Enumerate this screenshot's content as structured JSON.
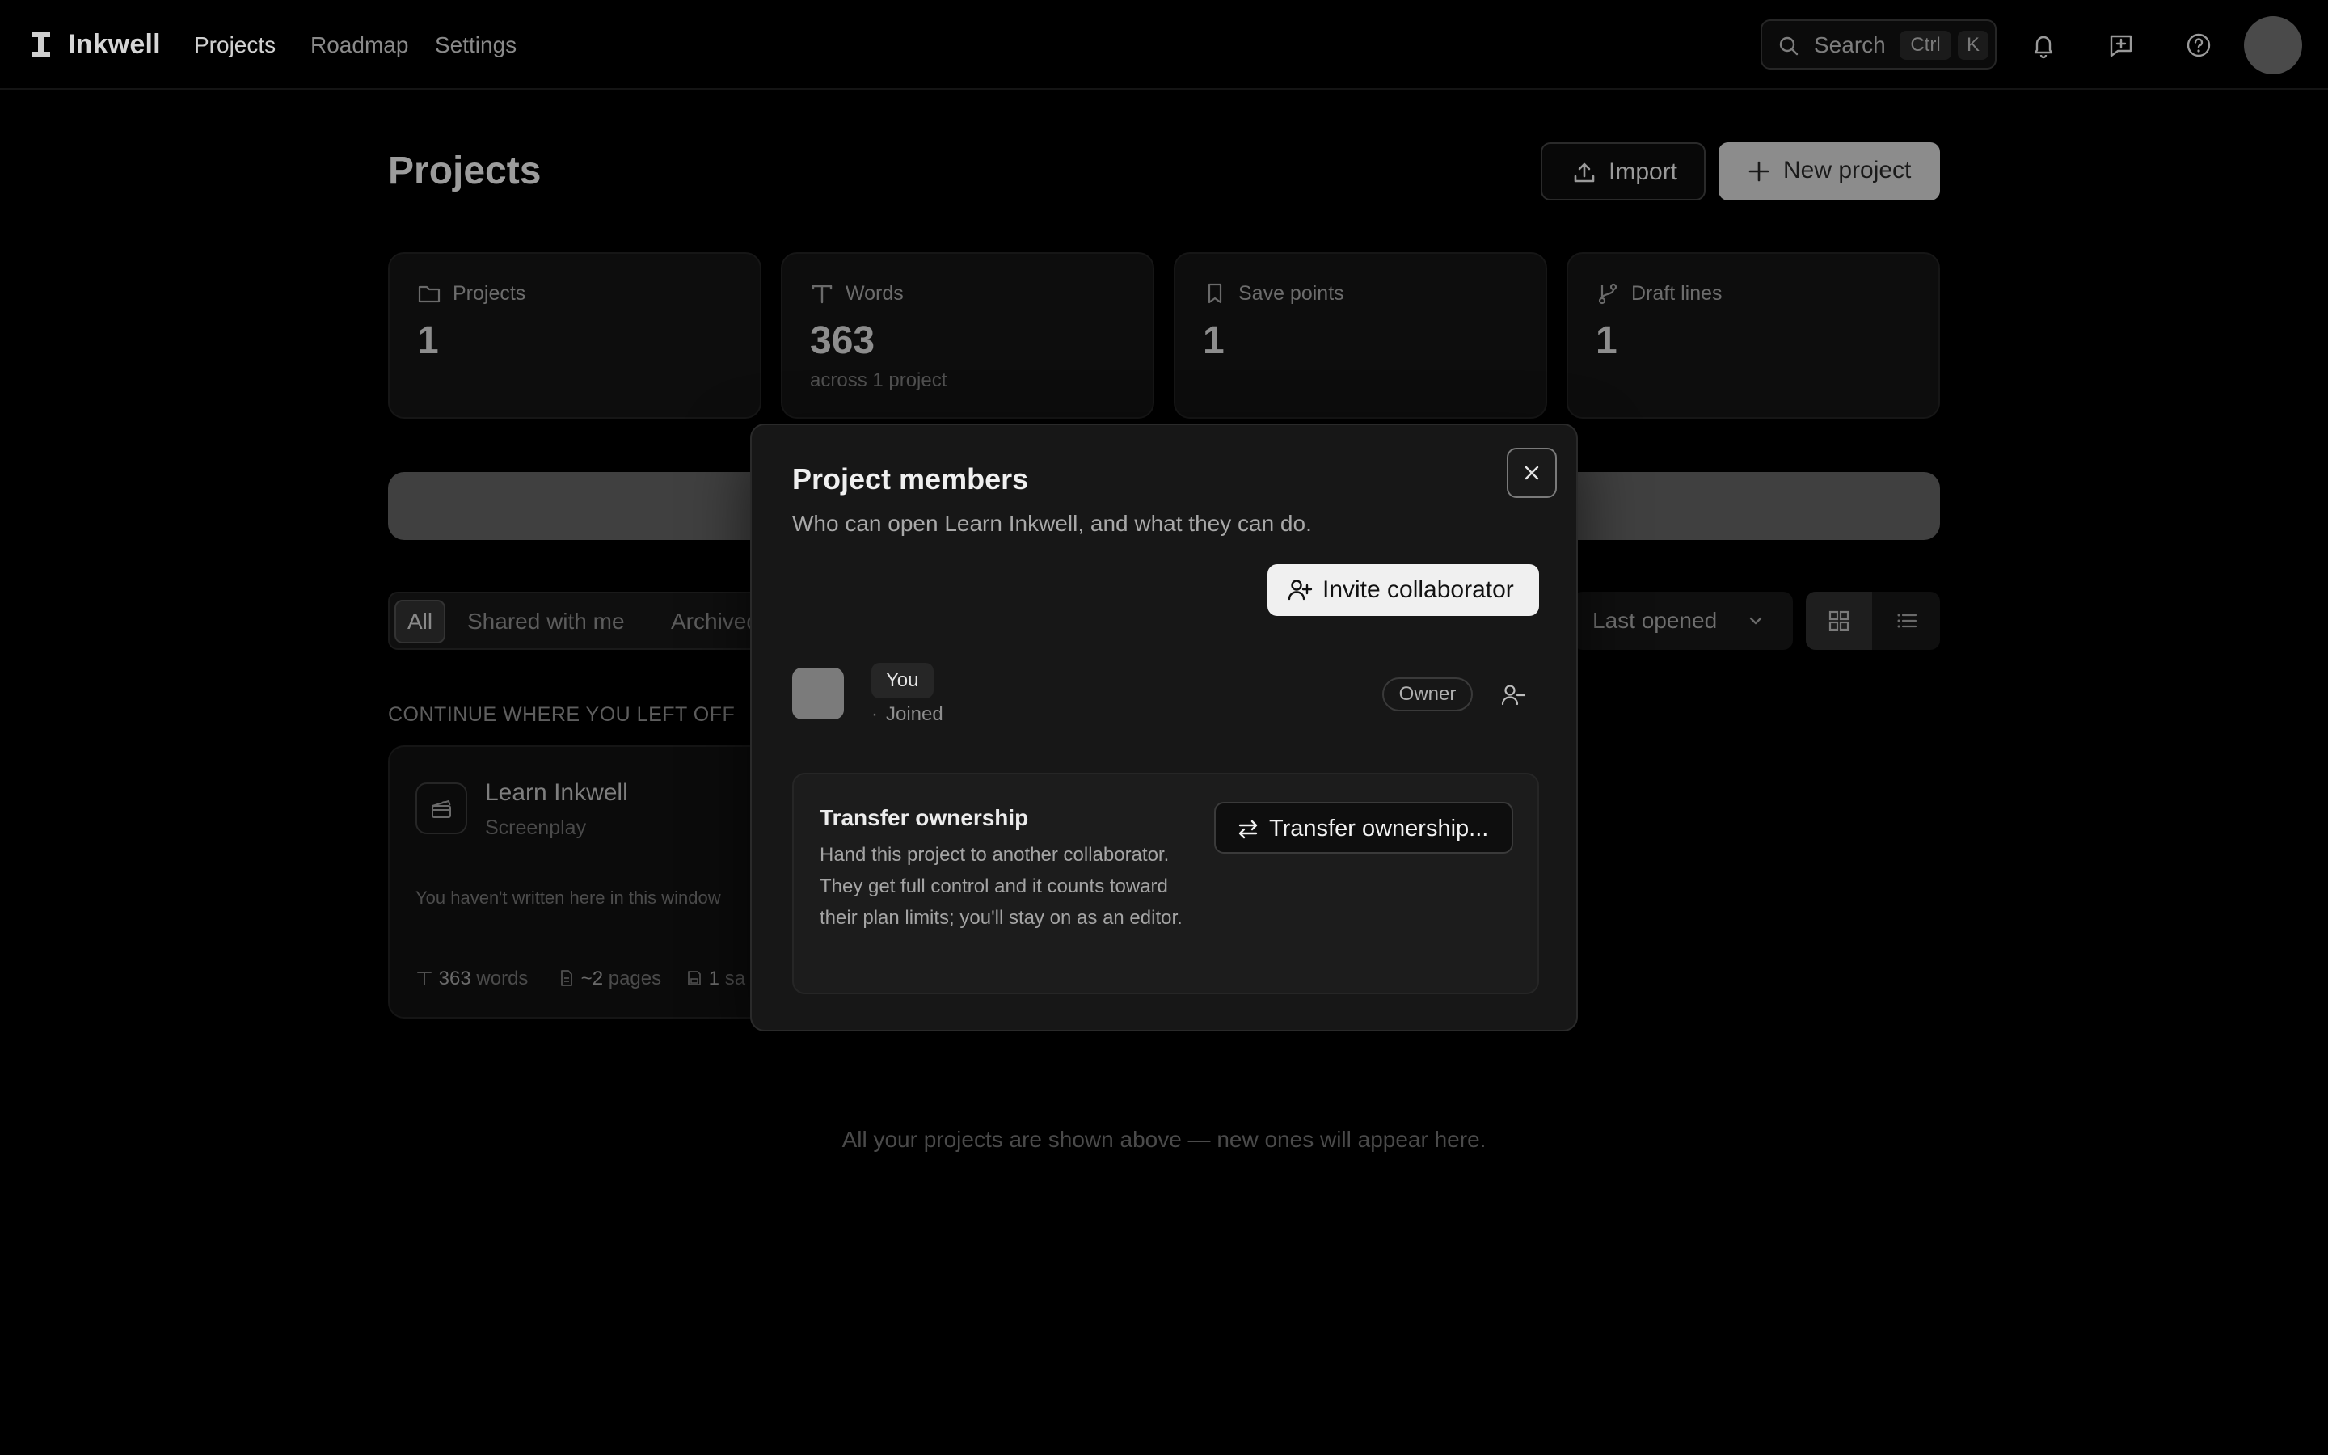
{
  "topbar": {
    "brand": "Inkwell",
    "nav": [
      {
        "label": "Projects",
        "active": true
      },
      {
        "label": "Roadmap",
        "active": false
      },
      {
        "label": "Settings",
        "active": false
      }
    ],
    "search": {
      "label": "Search",
      "kbd": [
        "Ctrl",
        "K"
      ]
    },
    "icons": [
      "bell-icon",
      "feedback-icon",
      "help-icon"
    ]
  },
  "page": {
    "title": "Projects",
    "import_label": "Import",
    "new_project_label": "New project",
    "stats": [
      {
        "icon": "folder-icon",
        "label": "Projects",
        "value": "1",
        "sub": ""
      },
      {
        "icon": "text-icon",
        "label": "Words",
        "value": "363",
        "sub": "across 1 project"
      },
      {
        "icon": "bookmark-icon",
        "label": "Save points",
        "value": "1",
        "sub": ""
      },
      {
        "icon": "branch-icon",
        "label": "Draft lines",
        "value": "1",
        "sub": ""
      }
    ],
    "filters": [
      {
        "label": "All",
        "active": true
      },
      {
        "label": "Shared with me",
        "active": false
      },
      {
        "label": "Archived",
        "active": false
      }
    ],
    "sort_label": "Last opened",
    "section_heading": "CONTINUE WHERE YOU LEFT OFF",
    "card": {
      "name": "Learn Inkwell",
      "kind": "Screenplay",
      "note": "You haven't written here in this window",
      "words_value": "363",
      "words_unit": "words",
      "pages_value": "~2",
      "pages_unit": "pages",
      "saves_value": "1",
      "saves_unit": "sa"
    },
    "footer_note": "All your projects are shown above — new ones will appear here."
  },
  "modal": {
    "title": "Project members",
    "description": "Who can open Learn Inkwell, and what they can do.",
    "invite_label": "Invite collaborator",
    "member": {
      "name": "You",
      "status_dot": "·",
      "status": "Joined",
      "role": "Owner"
    },
    "transfer": {
      "title": "Transfer ownership",
      "body": "Hand this project to another collaborator. They get full control and it counts toward their plan limits; you'll stay on as an editor.",
      "button_label": "Transfer ownership..."
    }
  }
}
